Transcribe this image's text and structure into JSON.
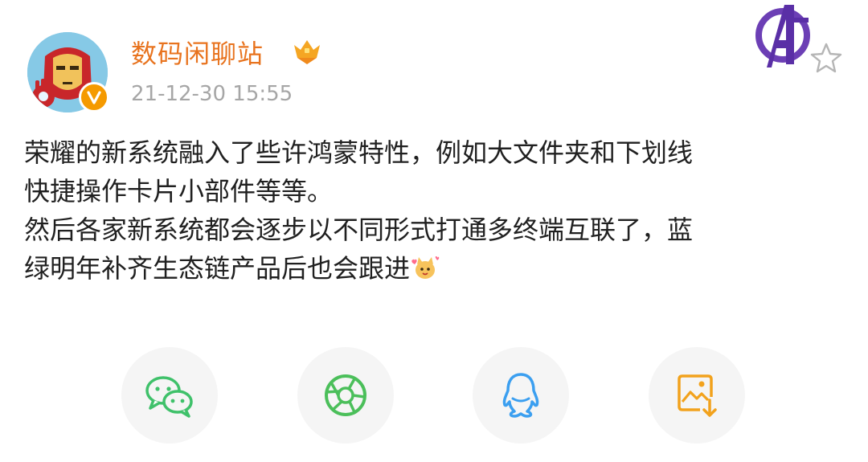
{
  "post": {
    "author": "数码闲聊站",
    "timestamp": "21-12-30 15:55",
    "lines": [
      "荣耀的新系统融入了些许鸿蒙特性，例如大文件夹和下划线",
      "快捷操作卡片小部件等等。",
      "然后各家新系统都会逐步以不同形式打通多终端互联了，蓝",
      "绿明年补齐生态链产品后也会跟进"
    ]
  },
  "icons": {
    "avatar": "avatar-iron-man",
    "verified": "verified-v-icon",
    "vip": "vip-crown-icon",
    "team_badge": "avengers-badge-icon",
    "favorite": "star-outline-icon",
    "emoji": "emoji-cat-icon"
  },
  "share": {
    "items": [
      {
        "icon": "wechat-icon"
      },
      {
        "icon": "moments-icon"
      },
      {
        "icon": "qq-icon"
      },
      {
        "icon": "save-image-icon"
      }
    ]
  },
  "colors": {
    "author": "#e8731e",
    "timestamp": "#a6a6a6",
    "text": "#202020",
    "wechat": "#3fc16a",
    "moments": "#4bbf5a",
    "qq": "#3b9ff0",
    "save": "#f2a21c",
    "button_bg": "#f5f5f5"
  }
}
